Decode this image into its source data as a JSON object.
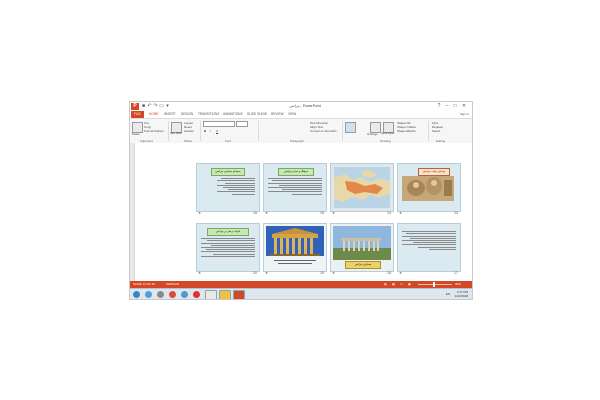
{
  "window": {
    "app_icon_letter": "P",
    "title": "بیزانس - PowerPoint",
    "controls": {
      "help": "?",
      "minimize": "–",
      "maximize": "□",
      "close": "✕"
    }
  },
  "tabs": {
    "file": "FILE",
    "items": [
      "HOME",
      "INSERT",
      "DESIGN",
      "TRANSITIONS",
      "ANIMATIONS",
      "SLIDE SHOW",
      "REVIEW",
      "VIEW"
    ],
    "sign_in": "Sign in"
  },
  "ribbon": {
    "clipboard": {
      "cut": "Cut",
      "copy": "Copy",
      "painter": "Format Painter",
      "paste": "Paste",
      "group": "Clipboard"
    },
    "slides": {
      "layout": "Layout",
      "reset": "Reset",
      "section": "Section",
      "new_slide": "New Slide",
      "group": "Slides"
    },
    "font": {
      "bold": "B",
      "italic": "I",
      "underline": "U",
      "group": "Font"
    },
    "paragraph": {
      "text_direction": "Text Direction",
      "align_text": "Align Text",
      "smartart": "Convert to SmartArt",
      "group": "Paragraph"
    },
    "drawing": {
      "arrange": "Arrange",
      "quick_styles": "Quick Styles",
      "shape_fill": "Shape Fill",
      "shape_outline": "Shape Outline",
      "shape_effects": "Shape Effects",
      "group": "Drawing"
    },
    "editing": {
      "find": "Find",
      "replace": "Replace",
      "select": "Select",
      "group": "Editing"
    }
  },
  "slides": [
    {
      "number": "16",
      "title": "سیستم سیاسی بیزانس",
      "has_title": true
    },
    {
      "number": "15",
      "title": "فرهنگ و تمدن بیزانس",
      "has_title": true
    },
    {
      "number": "14",
      "title": "",
      "has_title": false
    },
    {
      "number": "13",
      "title": "پیدایش دولت بیزانس",
      "has_title": true
    },
    {
      "number": "20",
      "title": "ادبیات و هنر در بیزانس",
      "has_title": true
    },
    {
      "number": "19",
      "title": "",
      "has_title": false
    },
    {
      "number": "18",
      "title": "معماری بیزانس",
      "has_title": false
    },
    {
      "number": "17",
      "title": "",
      "has_title": false
    }
  ],
  "status": {
    "slide_info": "SLIDE 13 OF 26",
    "language": "PERSIAN",
    "zoom": "39%"
  },
  "taskbar": {
    "time": "3:17 PM",
    "date": "1/22/2018",
    "lang": "EN"
  },
  "colors": {
    "accent": "#d24726",
    "slide_bg": "#dbe9f0",
    "title_box": "#c9e7b8"
  }
}
